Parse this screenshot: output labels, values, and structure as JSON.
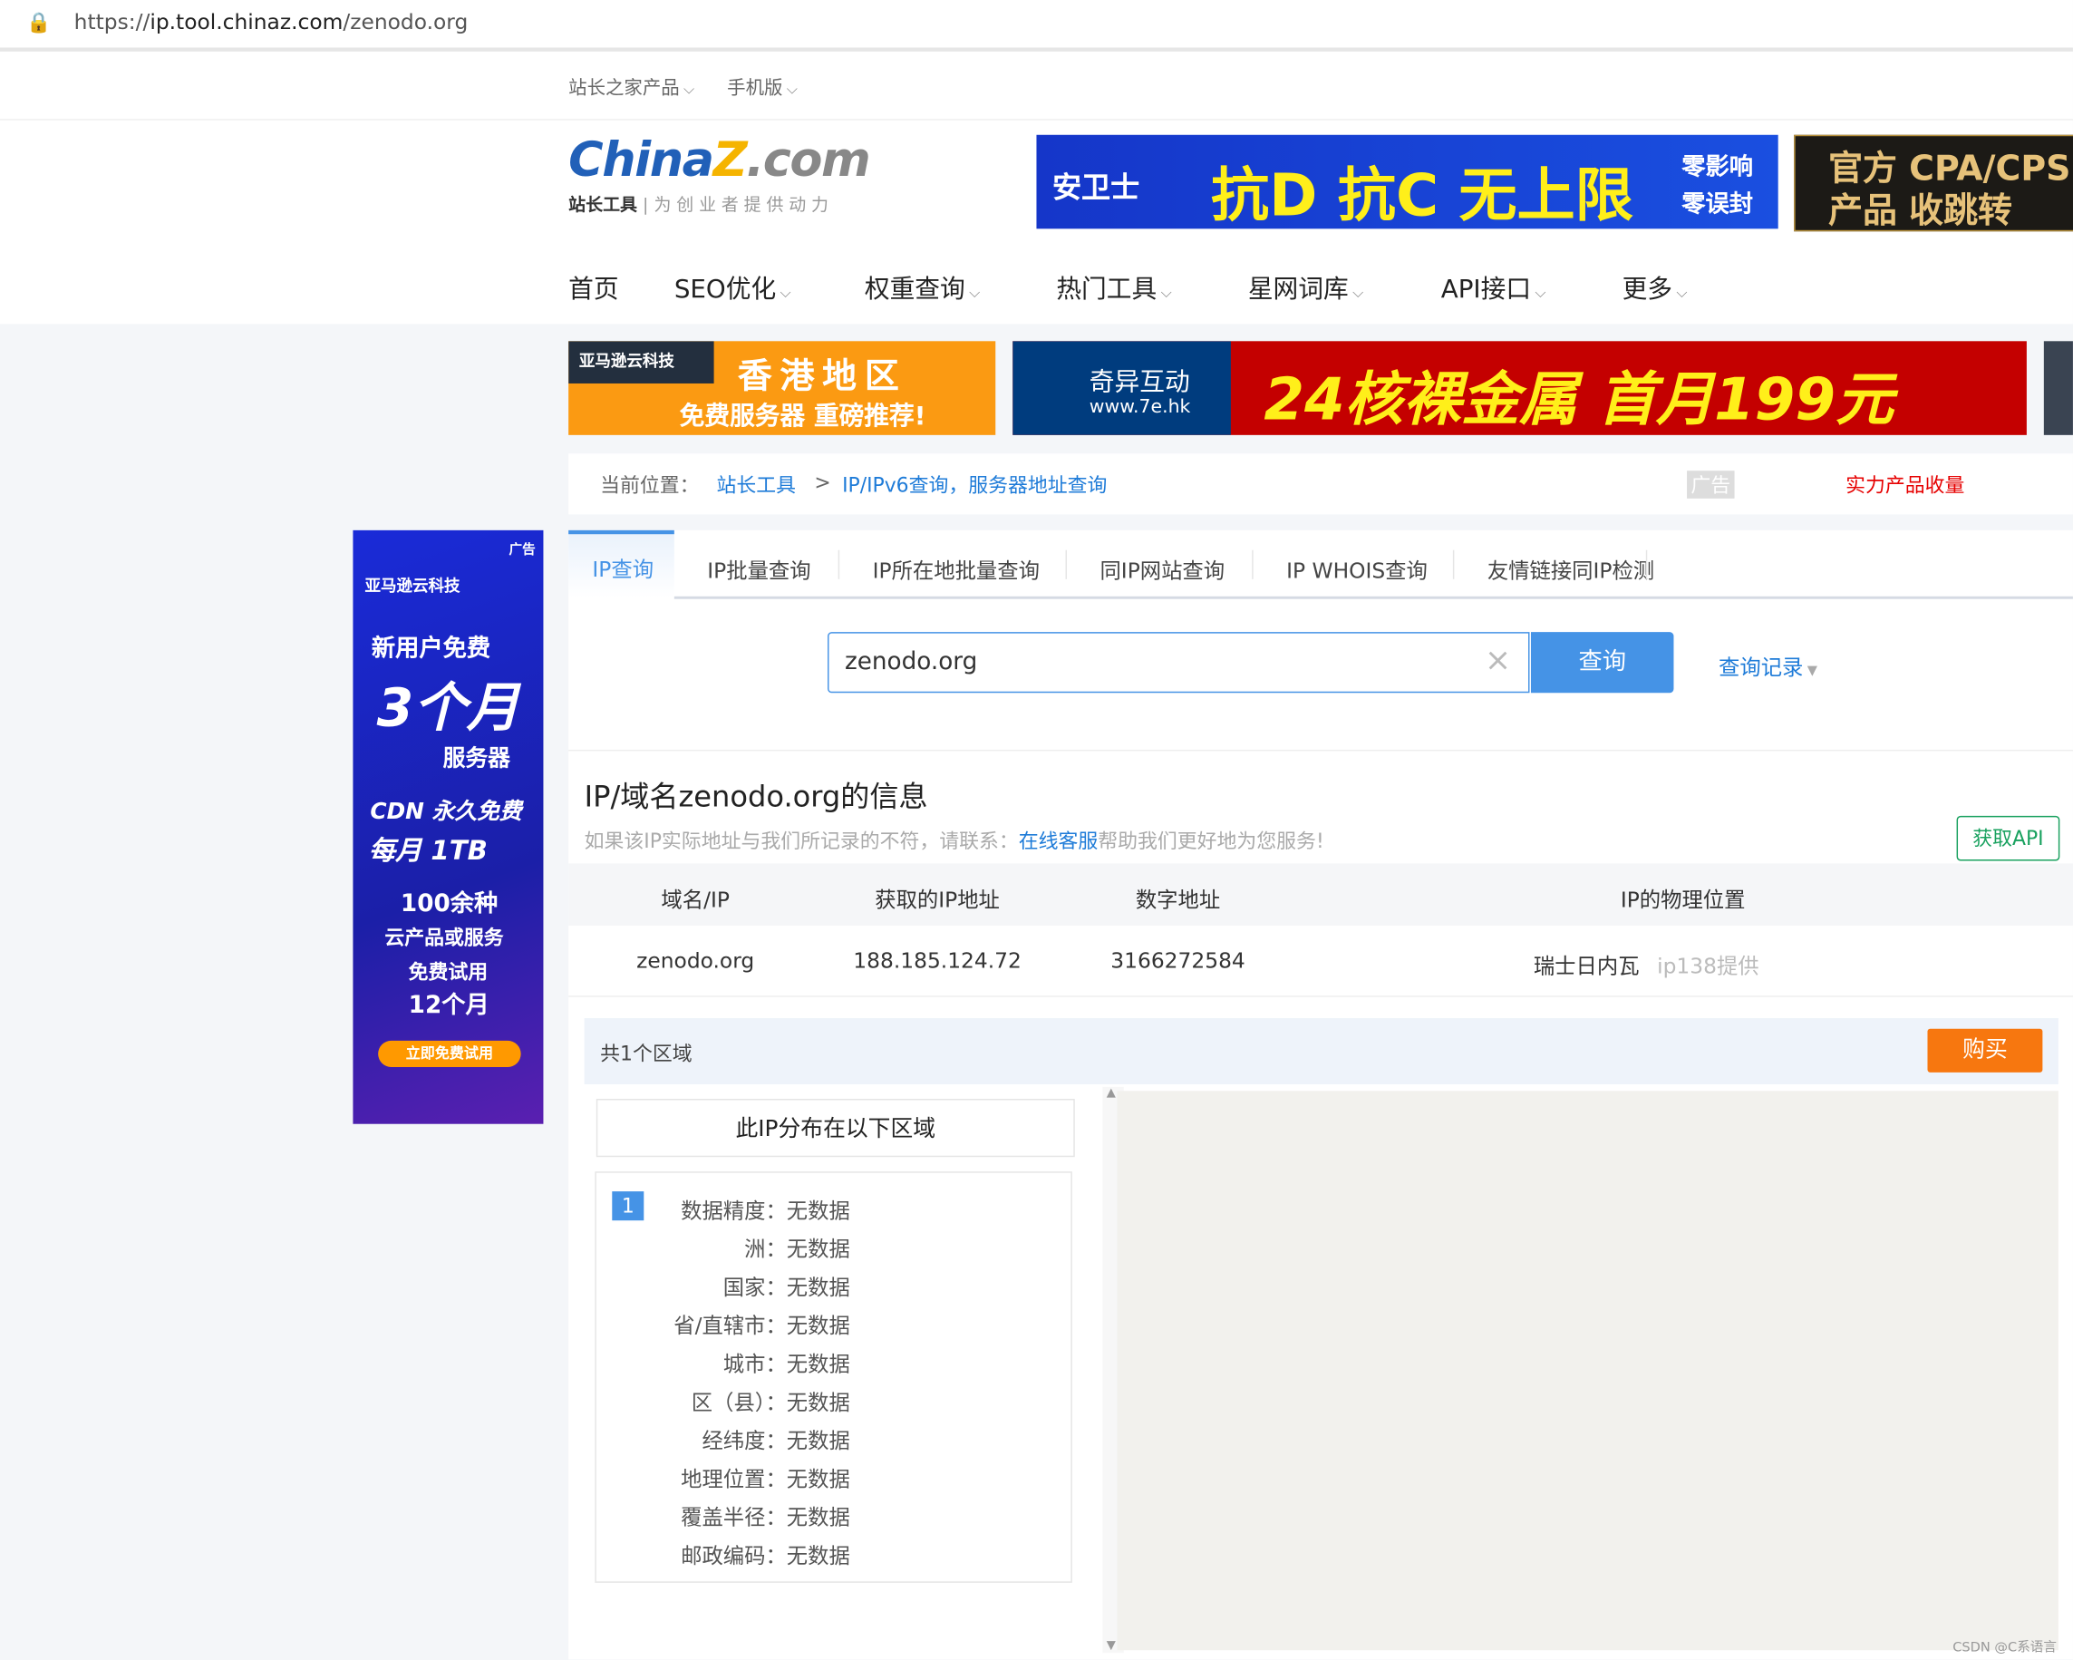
{
  "browser": {
    "url_prefix": "https://",
    "url_host": "ip.tool.chinaz.com",
    "url_path": "/zenodo.org"
  },
  "topbar": {
    "products": "站长之家产品",
    "mobile": "手机版"
  },
  "logo": {
    "text": "ChinaZ.com",
    "tagline_main": "站长工具",
    "tagline_sub": "为创业者提供动力"
  },
  "ads": {
    "banner1": {
      "brand": "安卫士",
      "headline": "抗D 抗C 无上限",
      "side1": "零影响",
      "side2": "零误封"
    },
    "banner2": {
      "line1": "官方 CPA/CPS",
      "line2": "产品 收跳转"
    },
    "banner3": {
      "brand": "亚马逊云科技",
      "headline": "香港地区",
      "sub": "免费服务器 重磅推荐!"
    },
    "banner4": {
      "brand": "奇异互动",
      "site": "www.7e.hk",
      "headline": "24核裸金属 首月199元"
    },
    "side": {
      "tag": "广告",
      "brand": "亚马逊云科技",
      "l1": "新用户免费",
      "l2": "3个月",
      "l3": "服务器",
      "l4": "CDN 永久免费",
      "l5": "每月 1TB",
      "l6": "100余种",
      "l7": "云产品或服务",
      "l8": "免费试用",
      "l9": "12个月",
      "cta": "立即免费试用"
    },
    "ad_tag": "广告"
  },
  "nav": [
    {
      "label": "首页"
    },
    {
      "label": "SEO优化"
    },
    {
      "label": "权重查询"
    },
    {
      "label": "热门工具"
    },
    {
      "label": "星网词库"
    },
    {
      "label": "API接口"
    },
    {
      "label": "更多"
    }
  ],
  "breadcrumb": {
    "prefix": "当前位置：",
    "home": "站长工具",
    "sep": ">",
    "current": "IP/IPv6查询，服务器地址查询",
    "ad": "广告",
    "promo": "实力产品收量"
  },
  "tabs": [
    {
      "label": "IP查询",
      "active": true
    },
    {
      "label": "IP批量查询"
    },
    {
      "label": "IP所在地批量查询"
    },
    {
      "label": "同IP网站查询"
    },
    {
      "label": "IP WHOIS查询"
    },
    {
      "label": "友情链接同IP检测"
    }
  ],
  "search": {
    "value": "zenodo.org",
    "button": "查询",
    "history": "查询记录"
  },
  "result": {
    "title": "IP/域名zenodo.org的信息",
    "notice_pre": "如果该IP实际地址与我们所记录的不符，请联系：",
    "notice_link": "在线客服",
    "notice_post": "帮助我们更好地为您服务!",
    "api_button": "获取API",
    "columns": [
      "域名/IP",
      "获取的IP地址",
      "数字地址",
      "IP的物理位置"
    ],
    "row": {
      "domain": "zenodo.org",
      "ip": "188.185.124.72",
      "numeric": "3166272584",
      "location": "瑞士日内瓦",
      "provider": "ip138提供"
    }
  },
  "regions": {
    "count": "共1个区域",
    "buy": "购买",
    "list_title": "此IP分布在以下区域",
    "index": "1",
    "fields": [
      {
        "label": "数据精度：",
        "value": "无数据"
      },
      {
        "label": "洲：",
        "value": "无数据"
      },
      {
        "label": "国家：",
        "value": "无数据"
      },
      {
        "label": "省/直辖市：",
        "value": "无数据"
      },
      {
        "label": "城市：",
        "value": "无数据"
      },
      {
        "label": "区（县）：",
        "value": "无数据"
      },
      {
        "label": "经纬度：",
        "value": "无数据"
      },
      {
        "label": "地理位置：",
        "value": "无数据"
      },
      {
        "label": "覆盖半径：",
        "value": "无数据"
      },
      {
        "label": "邮政编码：",
        "value": "无数据"
      }
    ]
  },
  "watermark": "CSDN @C系语言",
  "colors": {
    "primary": "#4593e6",
    "link": "#1e7bd8",
    "promo": "#e60000",
    "buy": "#f7770f",
    "api": "#19a15f"
  }
}
